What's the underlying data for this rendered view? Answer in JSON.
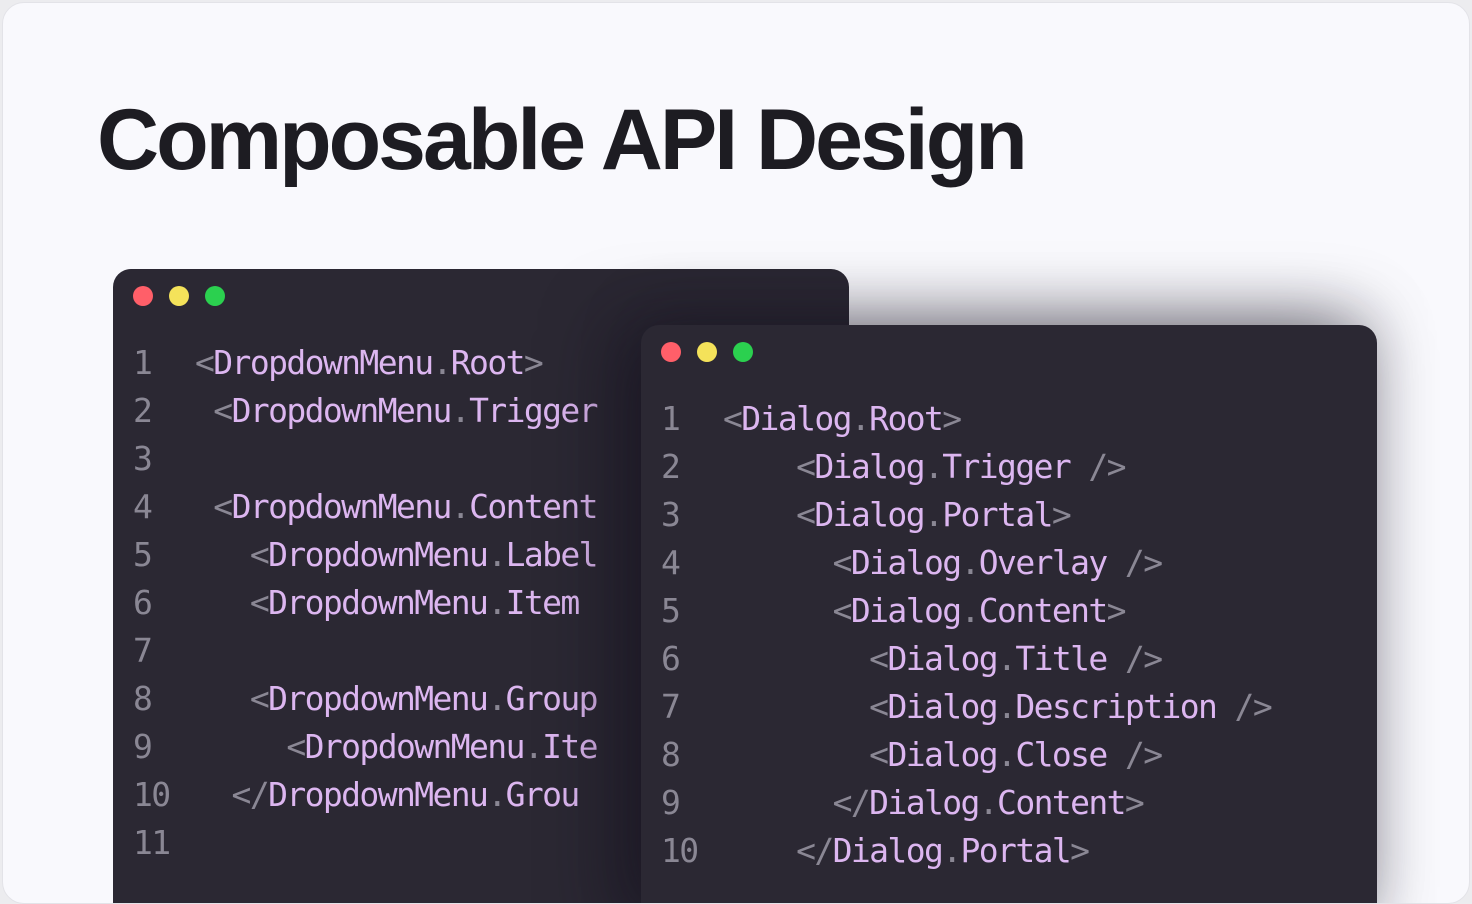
{
  "title": "Composable API Design",
  "colors": {
    "background": "#f9f9fd",
    "editor_bg": "#2b2833",
    "line_number": "#8a8794",
    "punctuation": "#8a8794",
    "identifier": "#dcb6f0",
    "dot_red": "#ff5f69",
    "dot_yellow": "#f4e25a",
    "dot_green": "#2bd04f"
  },
  "dropdown_window": {
    "lines": [
      {
        "num": "1",
        "indent": "",
        "open": "<",
        "comp": "DropdownMenu",
        "dot": ".",
        "part": "Root",
        "close": ">"
      },
      {
        "num": "2",
        "indent": " ",
        "open": "<",
        "comp": "DropdownMenu",
        "dot": ".",
        "part": "Trigger",
        "close": ""
      },
      {
        "num": "3",
        "indent": "",
        "open": "",
        "comp": "",
        "dot": "",
        "part": "",
        "close": ""
      },
      {
        "num": "4",
        "indent": " ",
        "open": "<",
        "comp": "DropdownMenu",
        "dot": ".",
        "part": "Content",
        "close": ""
      },
      {
        "num": "5",
        "indent": "   ",
        "open": "<",
        "comp": "DropdownMenu",
        "dot": ".",
        "part": "Label",
        "close": ""
      },
      {
        "num": "6",
        "indent": "   ",
        "open": "<",
        "comp": "DropdownMenu",
        "dot": ".",
        "part": "Item",
        "close": ""
      },
      {
        "num": "7",
        "indent": "",
        "open": "",
        "comp": "",
        "dot": "",
        "part": "",
        "close": ""
      },
      {
        "num": "8",
        "indent": "   ",
        "open": "<",
        "comp": "DropdownMenu",
        "dot": ".",
        "part": "Group",
        "close": ""
      },
      {
        "num": "9",
        "indent": "     ",
        "open": "<",
        "comp": "DropdownMenu",
        "dot": ".",
        "part": "Ite",
        "close": ""
      },
      {
        "num": "10",
        "indent": "  ",
        "open": "</",
        "comp": "DropdownMenu",
        "dot": ".",
        "part": "Grou",
        "close": ""
      },
      {
        "num": "11",
        "indent": "",
        "open": "",
        "comp": "",
        "dot": "",
        "part": "",
        "close": ""
      }
    ]
  },
  "dialog_window": {
    "lines": [
      {
        "num": "1",
        "indent": "",
        "open": "<",
        "comp": "Dialog",
        "dot": ".",
        "part": "Root",
        "close": ">"
      },
      {
        "num": "2",
        "indent": "    ",
        "open": "<",
        "comp": "Dialog",
        "dot": ".",
        "part": "Trigger",
        "close": " />"
      },
      {
        "num": "3",
        "indent": "    ",
        "open": "<",
        "comp": "Dialog",
        "dot": ".",
        "part": "Portal",
        "close": ">"
      },
      {
        "num": "4",
        "indent": "      ",
        "open": "<",
        "comp": "Dialog",
        "dot": ".",
        "part": "Overlay",
        "close": " />"
      },
      {
        "num": "5",
        "indent": "      ",
        "open": "<",
        "comp": "Dialog",
        "dot": ".",
        "part": "Content",
        "close": ">"
      },
      {
        "num": "6",
        "indent": "        ",
        "open": "<",
        "comp": "Dialog",
        "dot": ".",
        "part": "Title",
        "close": " />"
      },
      {
        "num": "7",
        "indent": "        ",
        "open": "<",
        "comp": "Dialog",
        "dot": ".",
        "part": "Description",
        "close": " />"
      },
      {
        "num": "8",
        "indent": "        ",
        "open": "<",
        "comp": "Dialog",
        "dot": ".",
        "part": "Close",
        "close": " />"
      },
      {
        "num": "9",
        "indent": "      ",
        "open": "</",
        "comp": "Dialog",
        "dot": ".",
        "part": "Content",
        "close": ">"
      },
      {
        "num": "10",
        "indent": "    ",
        "open": "</",
        "comp": "Dialog",
        "dot": ".",
        "part": "Portal",
        "close": ">"
      }
    ]
  }
}
